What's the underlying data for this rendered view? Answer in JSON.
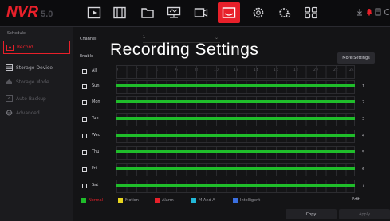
{
  "header": {
    "logo": "NVR",
    "version": "5.0",
    "icons": [
      {
        "name": "live-view-icon"
      },
      {
        "name": "playback-icon"
      },
      {
        "name": "file-icon"
      },
      {
        "name": "network-icon"
      },
      {
        "name": "camera-icon"
      },
      {
        "name": "record-icon",
        "active": true
      },
      {
        "name": "settings-icon"
      },
      {
        "name": "system-icon"
      },
      {
        "name": "apps-icon"
      }
    ],
    "status_icons": [
      "download-icon",
      "alarm-icon",
      "storage-icon"
    ]
  },
  "sidebar": {
    "title": "Schedule",
    "items": [
      {
        "label": "Record",
        "active": true
      },
      {
        "label": "Storage Device"
      },
      {
        "label": "Storage Mode"
      },
      {
        "label": "Auto Backup"
      },
      {
        "label": "Advanced"
      }
    ]
  },
  "form": {
    "channel_label": "Channel",
    "channel_value": "1",
    "enable_label": "Enable",
    "more_settings": "More Settings"
  },
  "overlay_title": "Recording Settings",
  "schedule": {
    "hours": [
      "0",
      "2",
      "4",
      "6",
      "8",
      "10",
      "12",
      "14",
      "16",
      "18",
      "20",
      "22",
      "24"
    ],
    "rows": [
      {
        "label": "All",
        "num": ""
      },
      {
        "label": "Sun",
        "num": "1"
      },
      {
        "label": "Mon",
        "num": "2"
      },
      {
        "label": "Tue",
        "num": "3"
      },
      {
        "label": "Wed",
        "num": "4"
      },
      {
        "label": "Thu",
        "num": "5"
      },
      {
        "label": "Fri",
        "num": "6"
      },
      {
        "label": "Sat",
        "num": "7"
      }
    ]
  },
  "legend": [
    {
      "label": "Normal",
      "color": "#1fbd2a"
    },
    {
      "label": "Motion",
      "color": "#e8d51e"
    },
    {
      "label": "Alarm",
      "color": "#e8202a"
    },
    {
      "label": "M And A",
      "color": "#22b8d8"
    },
    {
      "label": "Intelligent",
      "color": "#3a6fe0"
    }
  ],
  "buttons": {
    "edit": "Edit",
    "copy": "Copy",
    "apply": "Apply"
  },
  "colors": {
    "accent": "#e8202a",
    "normal_bar": "#1fbd2a"
  }
}
